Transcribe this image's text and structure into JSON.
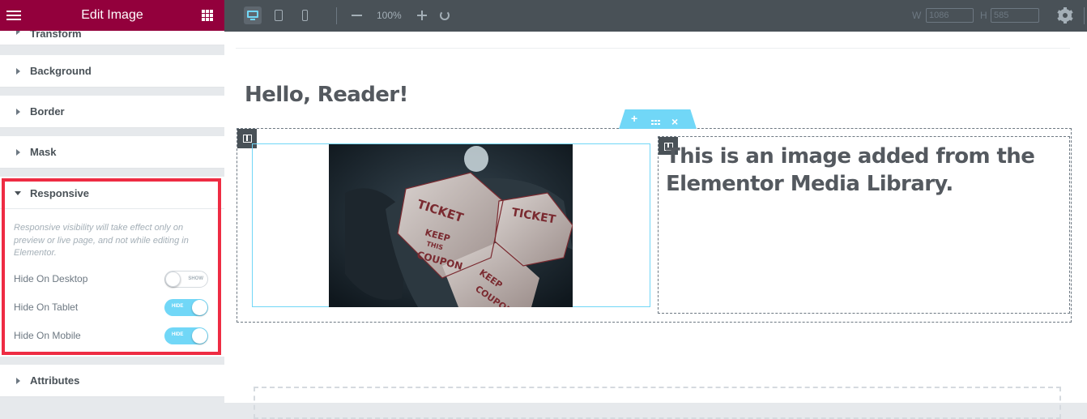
{
  "panel": {
    "title": "Edit Image",
    "sections": {
      "transform": "Transform",
      "background": "Background",
      "border": "Border",
      "mask": "Mask",
      "responsive": "Responsive",
      "attributes": "Attributes"
    },
    "responsive": {
      "note": "Responsive visibility will take effect only on preview or live page, and not while editing in Elementor.",
      "controls": [
        {
          "label": "Hide On Desktop",
          "state": "SHOW",
          "on": false
        },
        {
          "label": "Hide On Tablet",
          "state": "HIDE",
          "on": true
        },
        {
          "label": "Hide On Mobile",
          "state": "HIDE",
          "on": true
        }
      ]
    }
  },
  "topbar": {
    "zoom": "100%",
    "width_label": "W",
    "width_value": "1086",
    "height_label": "H",
    "height_value": "585",
    "active_device": "desktop"
  },
  "canvas": {
    "heading": "Hello, Reader!",
    "column_text": "This is an image added from the Elementor Media Library.",
    "section_handle": {
      "add": "+",
      "close": "×"
    }
  },
  "colors": {
    "panel_header": "#93003c",
    "accent": "#71d7f7",
    "highlight": "#ee2c43",
    "topbar": "#495157"
  }
}
